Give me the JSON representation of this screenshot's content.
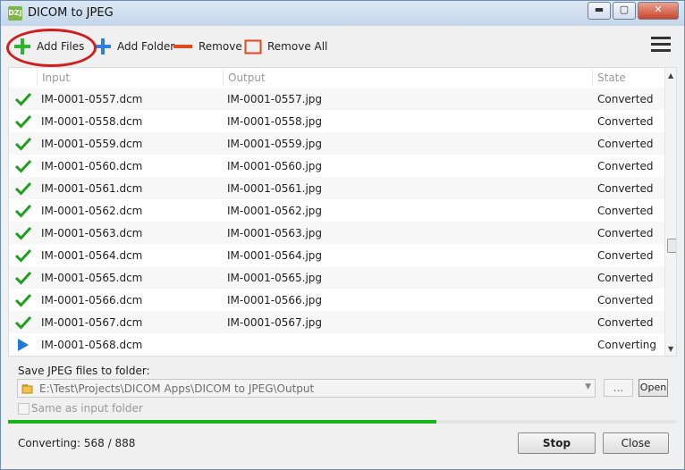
{
  "window": {
    "title": "DICOM to JPEG",
    "icon_text": "DZJ",
    "min_glyph": "▬",
    "max_glyph": "▢",
    "close_glyph": "✕"
  },
  "toolbar": {
    "add_files": "Add Files",
    "add_folder": "Add Folder",
    "remove": "Remove",
    "remove_all": "Remove All",
    "accent_add": "#2db52d",
    "accent_folder": "#2f7fe0",
    "accent_remove": "#e04a1a"
  },
  "grid": {
    "headers": {
      "input": "Input",
      "output": "Output",
      "state": "State"
    },
    "rows": [
      {
        "status": "check",
        "input": "IM-0001-0557.dcm",
        "output": "IM-0001-0557.jpg",
        "state": "Converted"
      },
      {
        "status": "check",
        "input": "IM-0001-0558.dcm",
        "output": "IM-0001-0558.jpg",
        "state": "Converted"
      },
      {
        "status": "check",
        "input": "IM-0001-0559.dcm",
        "output": "IM-0001-0559.jpg",
        "state": "Converted"
      },
      {
        "status": "check",
        "input": "IM-0001-0560.dcm",
        "output": "IM-0001-0560.jpg",
        "state": "Converted"
      },
      {
        "status": "check",
        "input": "IM-0001-0561.dcm",
        "output": "IM-0001-0561.jpg",
        "state": "Converted"
      },
      {
        "status": "check",
        "input": "IM-0001-0562.dcm",
        "output": "IM-0001-0562.jpg",
        "state": "Converted"
      },
      {
        "status": "check",
        "input": "IM-0001-0563.dcm",
        "output": "IM-0001-0563.jpg",
        "state": "Converted"
      },
      {
        "status": "check",
        "input": "IM-0001-0564.dcm",
        "output": "IM-0001-0564.jpg",
        "state": "Converted"
      },
      {
        "status": "check",
        "input": "IM-0001-0565.dcm",
        "output": "IM-0001-0565.jpg",
        "state": "Converted"
      },
      {
        "status": "check",
        "input": "IM-0001-0566.dcm",
        "output": "IM-0001-0566.jpg",
        "state": "Converted"
      },
      {
        "status": "check",
        "input": "IM-0001-0567.dcm",
        "output": "IM-0001-0567.jpg",
        "state": "Converted"
      },
      {
        "status": "play",
        "input": "IM-0001-0568.dcm",
        "output": "",
        "state": "Converting"
      }
    ]
  },
  "output_folder": {
    "label": "Save JPEG files to folder:",
    "path": "E:\\Test\\Projects\\DICOM Apps\\DICOM to JPEG\\Output",
    "browse_label": "...",
    "open_label": "Open",
    "dropdown_glyph": "▼"
  },
  "same_as_input": {
    "label": "Same as input folder",
    "checked": false
  },
  "progress": {
    "fraction": 0.64,
    "color": "#18b418"
  },
  "status": {
    "text": "Converting: 568 / 888"
  },
  "buttons": {
    "stop": "Stop",
    "close": "Close"
  }
}
